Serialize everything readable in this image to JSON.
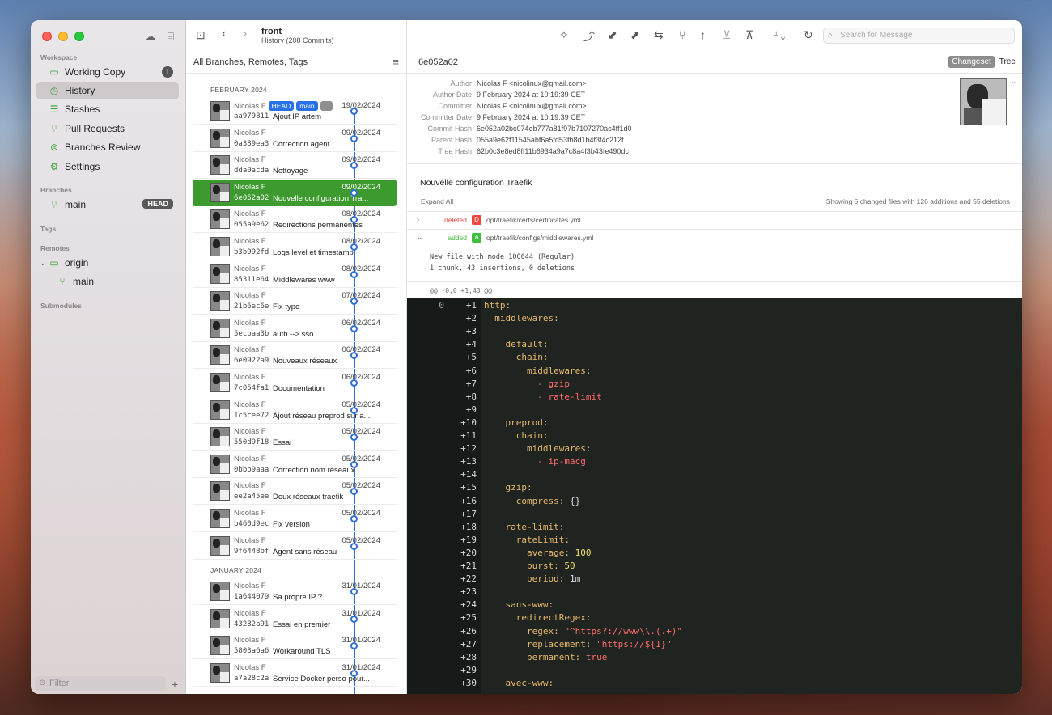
{
  "window": {
    "repo": "front",
    "subtitle": "History (208 Commits)"
  },
  "sidebar": {
    "workspace_label": "Workspace",
    "items": [
      {
        "label": "Working Copy",
        "icon": "folder-icon",
        "badge": "1"
      },
      {
        "label": "History",
        "icon": "clock-icon"
      },
      {
        "label": "Stashes",
        "icon": "stack-icon"
      },
      {
        "label": "Pull Requests",
        "icon": "pull-request-icon"
      },
      {
        "label": "Branches Review",
        "icon": "branch-review-icon"
      },
      {
        "label": "Settings",
        "icon": "gear-icon"
      }
    ],
    "branches_label": "Branches",
    "branch": {
      "label": "main",
      "badge": "HEAD"
    },
    "tags_label": "Tags",
    "remotes_label": "Remotes",
    "remote": {
      "label": "origin",
      "child": "main"
    },
    "submodules_label": "Submodules",
    "filter_placeholder": "Filter"
  },
  "list": {
    "header": "All Branches, Remotes, Tags",
    "months": [
      "FEBRUARY 2024",
      "JANUARY 2024"
    ],
    "tags": [
      "HEAD",
      "main",
      "..."
    ],
    "commits": [
      {
        "author": "Nicolas F",
        "date": "19/02/2024",
        "hash": "aa979811",
        "msg": "Ajout IP artem"
      },
      {
        "author": "Nicolas F",
        "date": "09/02/2024",
        "hash": "0a389ea3",
        "msg": "Correction agent"
      },
      {
        "author": "Nicolas F",
        "date": "09/02/2024",
        "hash": "dda0acda",
        "msg": "Nettoyage"
      },
      {
        "author": "Nicolas F",
        "date": "09/02/2024",
        "hash": "6e052a02",
        "msg": "Nouvelle configuration Tra..."
      },
      {
        "author": "Nicolas F",
        "date": "08/02/2024",
        "hash": "055a9e62",
        "msg": "Redirections permanentes"
      },
      {
        "author": "Nicolas F",
        "date": "08/02/2024",
        "hash": "b3b992fd",
        "msg": "Logs level et timestamp"
      },
      {
        "author": "Nicolas F",
        "date": "08/02/2024",
        "hash": "85311e64",
        "msg": "Middlewares www"
      },
      {
        "author": "Nicolas F",
        "date": "07/02/2024",
        "hash": "21b6ec6e",
        "msg": "Fix typo"
      },
      {
        "author": "Nicolas F",
        "date": "06/02/2024",
        "hash": "5ecbaa3b",
        "msg": "auth --> sso"
      },
      {
        "author": "Nicolas F",
        "date": "06/02/2024",
        "hash": "6e0922a9",
        "msg": "Nouveaux réseaux"
      },
      {
        "author": "Nicolas F",
        "date": "06/02/2024",
        "hash": "7c054fa1",
        "msg": "Documentation"
      },
      {
        "author": "Nicolas F",
        "date": "05/02/2024",
        "hash": "1c5cee72",
        "msg": "Ajout réseau preprod sur a..."
      },
      {
        "author": "Nicolas F",
        "date": "05/02/2024",
        "hash": "550d9f18",
        "msg": "Essai"
      },
      {
        "author": "Nicolas F",
        "date": "05/02/2024",
        "hash": "0bbb9aaa",
        "msg": "Correction nom réseaux"
      },
      {
        "author": "Nicolas F",
        "date": "05/02/2024",
        "hash": "ee2a45ee",
        "msg": "Deux réseaux traefik"
      },
      {
        "author": "Nicolas F",
        "date": "05/02/2024",
        "hash": "b460d9ec",
        "msg": "Fix version"
      },
      {
        "author": "Nicolas F",
        "date": "05/02/2024",
        "hash": "9f6448bf",
        "msg": "Agent sans réseau"
      },
      {
        "author": "Nicolas F",
        "date": "31/01/2024",
        "hash": "1a644079",
        "msg": "Sa propre IP ?"
      },
      {
        "author": "Nicolas F",
        "date": "31/01/2024",
        "hash": "43282a91",
        "msg": "Essai en premier"
      },
      {
        "author": "Nicolas F",
        "date": "31/01/2024",
        "hash": "5803a6a6",
        "msg": "Workaround TLS"
      },
      {
        "author": "Nicolas F",
        "date": "31/01/2024",
        "hash": "a7a28c2a",
        "msg": "Service Docker perso pour..."
      }
    ]
  },
  "toolbar": {
    "search_placeholder": "Search for Message"
  },
  "detail": {
    "hash": "6e052a02",
    "seg_changeset": "Changeset",
    "seg_tree": "Tree",
    "meta": [
      {
        "k": "Author",
        "v": "Nicolas F <nicolinux@gmail.com>"
      },
      {
        "k": "Author Date",
        "v": "9 February 2024 at 10:19:39 CET"
      },
      {
        "k": "Committer",
        "v": "Nicolas F <nicolinux@gmail.com>"
      },
      {
        "k": "Committer Date",
        "v": "9 February 2024 at 10:19:39 CET"
      },
      {
        "k": "Commit Hash",
        "v": "6e052a02bc074eb777a81f97b7107270ac4ff1d0"
      },
      {
        "k": "Parent Hash",
        "v": "055a9e62f11545abf6a5fd53fb8d1b4f3f4c212f"
      },
      {
        "k": "Tree Hash",
        "v": "62b0c3e8ed8ff11b6934a9a7c8a4f3b43fe490dc"
      }
    ],
    "subject": "Nouvelle configuration Traefik",
    "expand_all": "Expand All",
    "showing": "Showing 5 changed files with 126 additions and 55 deletions",
    "files": [
      {
        "status": "deleted",
        "letter": "D",
        "color": "#f0453a",
        "path": "opt/traefik/certs/certificates.yml",
        "chev": "›"
      },
      {
        "status": "added",
        "letter": "A",
        "color": "#3fbf3f",
        "path": "opt/traefik/configs/middlewares.yml",
        "chev": "⌄"
      }
    ],
    "file_info": [
      "New file with mode 100644 (Regular)",
      "1 chunk, 43 insertions, 0 deletions"
    ],
    "hunk": "@@ -0,0 +1,43 @@",
    "old_line": "0"
  },
  "code": [
    "http:",
    "  middlewares:",
    "",
    "    default:",
    "      chain:",
    "        middlewares:",
    "          - gzip",
    "          - rate-limit",
    "",
    "    preprod:",
    "      chain:",
    "        middlewares:",
    "          - ip-macg",
    "",
    "    gzip:",
    "      compress: {}",
    "",
    "    rate-limit:",
    "      rateLimit:",
    "        average: 100",
    "        burst: 50",
    "        period: 1m",
    "",
    "    sans-www:",
    "      redirectRegex:",
    "        regex: \"^https?://www\\\\.(.+)\"",
    "        replacement: \"https://${1}\"",
    "        permanent: true",
    "",
    "    avec-www:"
  ]
}
